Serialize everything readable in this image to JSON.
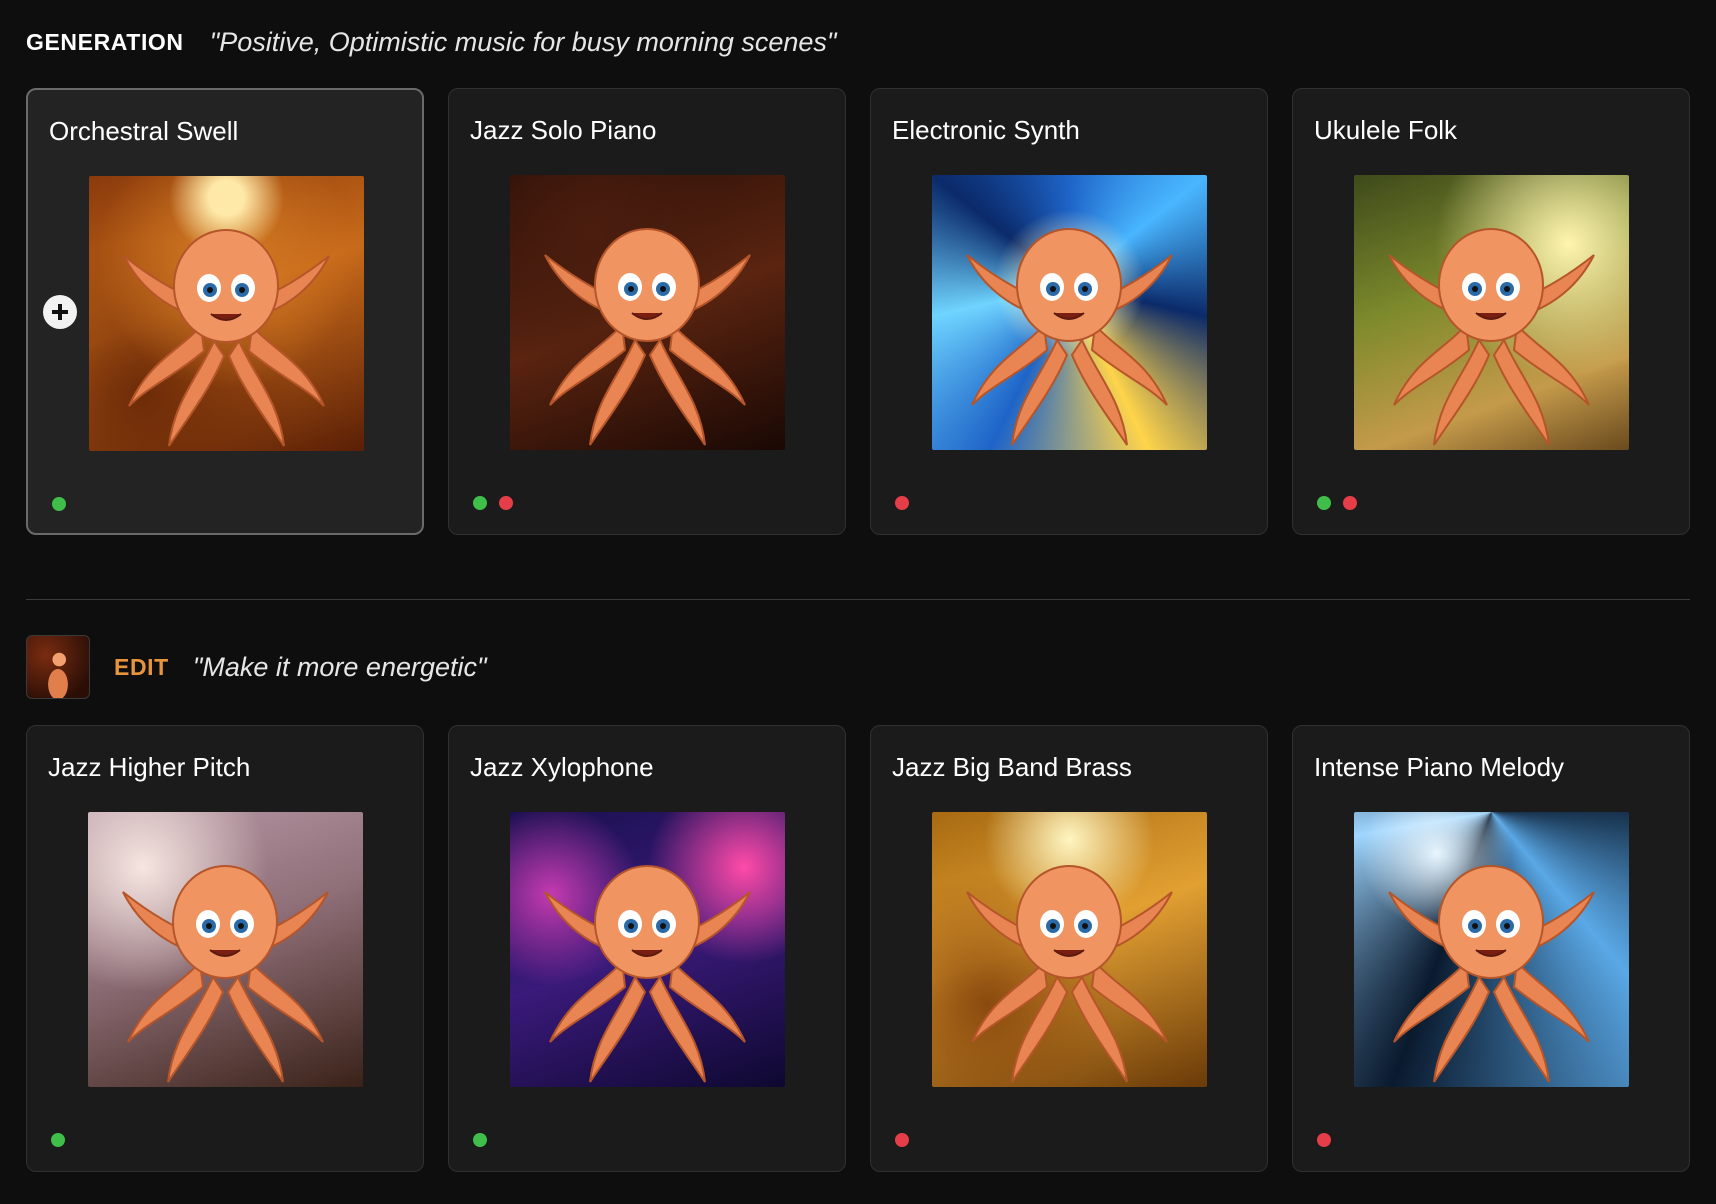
{
  "generation": {
    "tag": "GENERATION",
    "prompt": "\"Positive, Optimistic music for busy morning scenes\""
  },
  "edit": {
    "tag": "EDIT",
    "prompt": "\"Make it more energetic\""
  },
  "colors": {
    "edit_accent": "#e8943c",
    "status_green": "#3fbf4a",
    "status_red": "#e53e48"
  },
  "generation_cards": [
    {
      "title": "Orchestral Swell",
      "image": "octopus-conductor-orchestra",
      "status": [
        "green"
      ],
      "selected": true
    },
    {
      "title": "Jazz Solo Piano",
      "image": "octopus-playing-piano-jazz-club",
      "status": [
        "green",
        "red"
      ],
      "selected": false
    },
    {
      "title": "Electronic Synth",
      "image": "octopus-playing-synthesizer",
      "status": [
        "red"
      ],
      "selected": false
    },
    {
      "title": "Ukulele Folk",
      "image": "octopus-playing-ukulele",
      "status": [
        "green",
        "red"
      ],
      "selected": false
    }
  ],
  "edit_cards": [
    {
      "title": "Jazz Higher Pitch",
      "image": "octopus-playing-grand-piano",
      "status": [
        "green"
      ]
    },
    {
      "title": "Jazz Xylophone",
      "image": "octopus-trumpet-double-bass",
      "status": [
        "green"
      ]
    },
    {
      "title": "Jazz Big Band Brass",
      "image": "octopus-big-band",
      "status": [
        "red"
      ]
    },
    {
      "title": "Intense Piano Melody",
      "image": "octopus-intense-piano",
      "status": [
        "red"
      ]
    }
  ]
}
